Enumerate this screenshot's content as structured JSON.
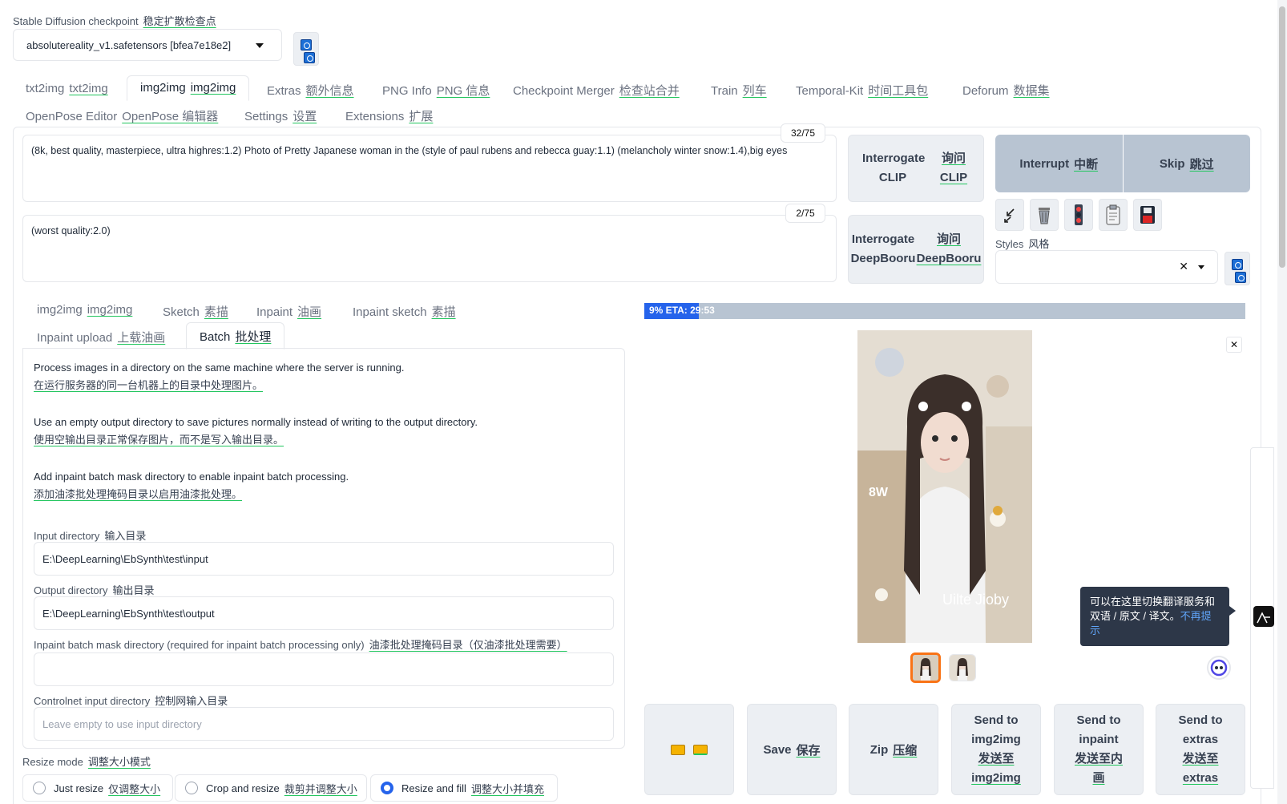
{
  "checkpoint": {
    "label_en": "Stable Diffusion checkpoint",
    "label_cn": "稳定扩散检查点",
    "value": "absolutereality_v1.safetensors [bfea7e18e2]"
  },
  "main_tabs": [
    {
      "en": "txt2img",
      "cn": "txt2img"
    },
    {
      "en": "img2img",
      "cn": "img2img"
    },
    {
      "en": "Extras",
      "cn": "额外信息"
    },
    {
      "en": "PNG Info",
      "cn": "PNG 信息"
    },
    {
      "en": "Checkpoint Merger",
      "cn": "检查站合并"
    },
    {
      "en": "Train",
      "cn": "列车"
    },
    {
      "en": "Temporal-Kit",
      "cn": "时间工具包"
    },
    {
      "en": "Deforum",
      "cn": "数据集"
    },
    {
      "en": "OpenPose Editor",
      "cn": "OpenPose 编辑器"
    },
    {
      "en": "Settings",
      "cn": "设置"
    },
    {
      "en": "Extensions",
      "cn": "扩展"
    }
  ],
  "prompt": {
    "text": "(8k, best quality, masterpiece, ultra highres:1.2) Photo of Pretty Japanese woman in the (style of paul rubens and rebecca guay:1.1) (melancholy winter snow:1.4),big eyes",
    "token_count": "32/75"
  },
  "negative_prompt": {
    "text": "(worst quality:2.0)",
    "token_count": "2/75"
  },
  "interrogate": {
    "clip_en": "Interrogate CLIP",
    "clip_cn": "询问 CLIP",
    "deepbooru_en": "Interrogate DeepBooru",
    "deepbooru_cn": "询问 DeepBooru"
  },
  "actions": {
    "interrupt_en": "Interrupt",
    "interrupt_cn": "中断",
    "skip_en": "Skip",
    "skip_cn": "跳过"
  },
  "styles": {
    "label_en": "Styles",
    "label_cn": "风格",
    "value": ""
  },
  "sub_tabs": [
    {
      "en": "img2img",
      "cn": "img2img"
    },
    {
      "en": "Sketch",
      "cn": "素描"
    },
    {
      "en": "Inpaint",
      "cn": "油画"
    },
    {
      "en": "Inpaint sketch",
      "cn": "素描"
    },
    {
      "en": "Inpaint upload",
      "cn": "上载油画"
    },
    {
      "en": "Batch",
      "cn": "批处理"
    }
  ],
  "batch": {
    "desc1_en": "Process images in a directory on the same machine where the server is running.",
    "desc1_cn": "在运行服务器的同一台机器上的目录中处理图片。",
    "desc2_en": "Use an empty output directory to save pictures normally instead of writing to the output directory.",
    "desc2_cn": "使用空输出目录正常保存图片，而不是写入输出目录。",
    "desc3_en": "Add inpaint batch mask directory to enable inpaint batch processing.",
    "desc3_cn": "添加油漆批处理掩码目录以启用油漆批处理。",
    "input_label_en": "Input directory",
    "input_label_cn": "输入目录",
    "input_value": "E:\\DeepLearning\\EbSynth\\test\\input",
    "output_label_en": "Output directory",
    "output_label_cn": "输出目录",
    "output_value": "E:\\DeepLearning\\EbSynth\\test\\output",
    "mask_label_en": "Inpaint batch mask directory (required for inpaint batch processing only)",
    "mask_label_cn": "油漆批处理掩码目录（仅油漆批处理需要）",
    "mask_value": "",
    "controlnet_label_en": "Controlnet input directory",
    "controlnet_label_cn": "控制网输入目录",
    "controlnet_placeholder": "Leave empty to use input directory"
  },
  "resize_mode": {
    "label_en": "Resize mode",
    "label_cn": "调整大小模式",
    "options": [
      {
        "en": "Just resize",
        "cn": "仅调整大小"
      },
      {
        "en": "Crop and resize",
        "cn": "裁剪并调整大小"
      },
      {
        "en": "Resize and fill",
        "cn": "调整大小并填充"
      }
    ],
    "selected": "Resize and fill"
  },
  "progress": {
    "text": "9% ETA: 29:53",
    "fraction": 0.09
  },
  "image": {
    "watermark_left": "8W",
    "watermark_right": "Uilte Jioby"
  },
  "output_buttons": {
    "save_en": "Save",
    "save_cn": "保存",
    "zip_en": "Zip",
    "zip_cn": "压缩",
    "send_img2img_en": "Send to img2img",
    "send_img2img_cn": "发送至 img2img",
    "send_inpaint_en": "Send to inpaint",
    "send_inpaint_cn": "发送至内画",
    "send_extras_en": "Send to extras",
    "send_extras_cn": "发送至 extras"
  },
  "tooltip": {
    "text": "可以在这里切换翻译服务和双语 / 原文 / 译文。",
    "link": "不再提示"
  },
  "colors": {
    "accent": "#1d6fd6",
    "progress": "#2563eb",
    "orange": "#f97316"
  }
}
